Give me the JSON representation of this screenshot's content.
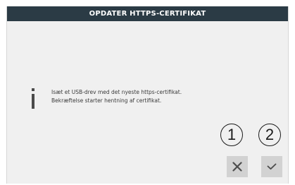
{
  "dialog": {
    "title": "OPDATER HTTPS-CERTIFIKAT",
    "message_line1": "Isæt et USB-drev med det nyeste https-certifikat.",
    "message_line2": "Bekræftelse starter hentning af certifikat.",
    "info_icon": "info-icon"
  },
  "callouts": {
    "cancel_number": "1",
    "confirm_number": "2"
  },
  "buttons": {
    "cancel_icon": "close-icon",
    "confirm_icon": "check-icon"
  },
  "colors": {
    "titlebar": "#2b3b45",
    "dialog_bg": "#f0f0f0",
    "button_bg": "#d2d2d2",
    "icon": "#555555"
  }
}
